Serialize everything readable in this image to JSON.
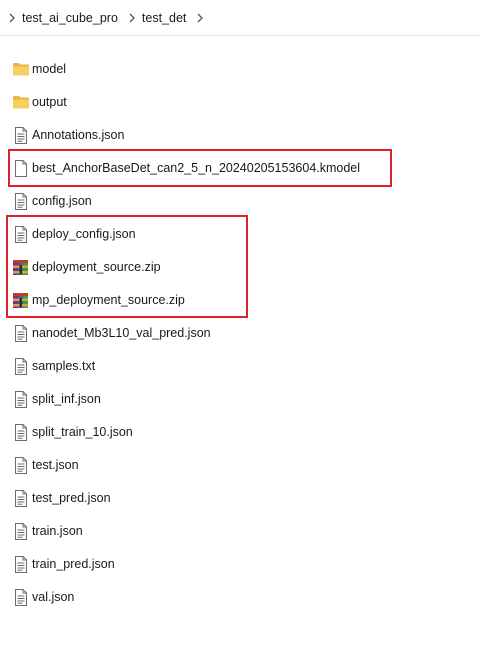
{
  "breadcrumb": {
    "items": [
      "test_ai_cube_pro",
      "test_det"
    ]
  },
  "files": [
    {
      "name": "model",
      "type": "folder"
    },
    {
      "name": "output",
      "type": "folder"
    },
    {
      "name": "Annotations.json",
      "type": "json"
    },
    {
      "name": "best_AnchorBaseDet_can2_5_n_20240205153604.kmodel",
      "type": "blank"
    },
    {
      "name": "config.json",
      "type": "json"
    },
    {
      "name": "deploy_config.json",
      "type": "json"
    },
    {
      "name": "deployment_source.zip",
      "type": "zip"
    },
    {
      "name": "mp_deployment_source.zip",
      "type": "zip"
    },
    {
      "name": "nanodet_Mb3L10_val_pred.json",
      "type": "json"
    },
    {
      "name": "samples.txt",
      "type": "json"
    },
    {
      "name": "split_inf.json",
      "type": "json"
    },
    {
      "name": "split_train_10.json",
      "type": "json"
    },
    {
      "name": "test.json",
      "type": "json"
    },
    {
      "name": "test_pred.json",
      "type": "json"
    },
    {
      "name": "train.json",
      "type": "json"
    },
    {
      "name": "train_pred.json",
      "type": "json"
    },
    {
      "name": "val.json",
      "type": "json"
    }
  ],
  "icons": {
    "folder": "folder-icon",
    "json": "text-document-icon",
    "blank": "blank-document-icon",
    "zip": "winrar-archive-icon"
  },
  "colors": {
    "highlight": "#e0202a",
    "folder": "#f5c451"
  }
}
